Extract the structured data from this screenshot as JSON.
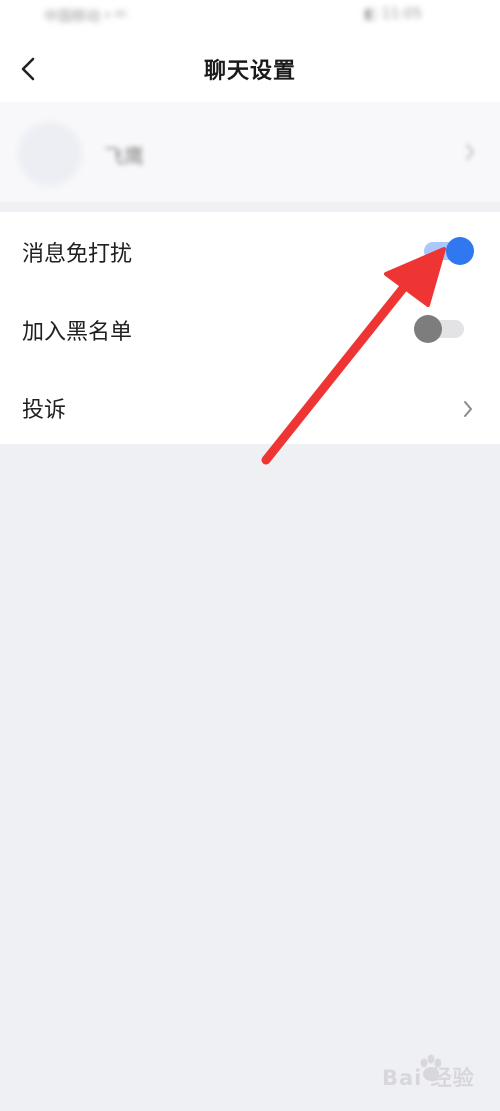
{
  "status_bar": {
    "left_text": "中国移动 ᵍ ⁴ᴳ",
    "right_text": "◧ 11:05"
  },
  "nav": {
    "title": "聊天设置",
    "back_icon": "chevron-left-icon"
  },
  "profile": {
    "name": "飞鹰",
    "chevron_icon": "chevron-right-icon"
  },
  "settings": {
    "do_not_disturb": {
      "label": "消息免打扰",
      "enabled": true
    },
    "blacklist": {
      "label": "加入黑名单",
      "enabled": false
    },
    "report": {
      "label": "投诉",
      "chevron_icon": "chevron-right-icon"
    }
  },
  "colors": {
    "toggle_on_knob": "#2f78ef",
    "toggle_on_track": "#a9c8ff",
    "toggle_off_knob": "#7d7d7d",
    "toggle_off_track": "#e3e3e6",
    "annotation_arrow": "#ef3434",
    "page_background": "#eff0f4"
  },
  "watermark": {
    "text": "Bai 经验",
    "icon": "paw-icon"
  }
}
